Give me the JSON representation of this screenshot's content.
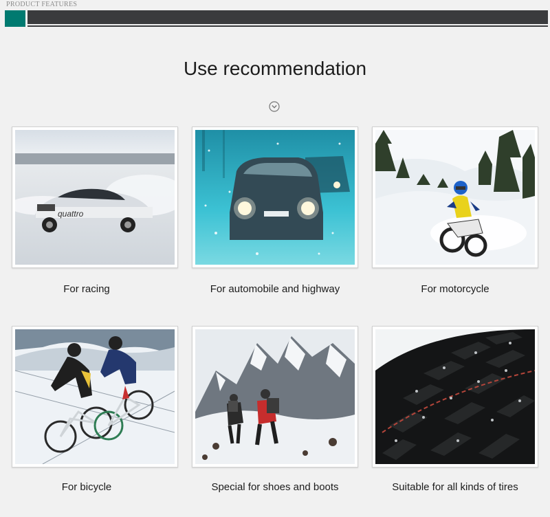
{
  "header": {
    "label": "PRODUCT FEATURES",
    "accent_color": "#007a70",
    "bar_color": "#3a3b3d"
  },
  "section": {
    "title": "Use recommendation",
    "chevron_icon": "chevron-down-circle-icon"
  },
  "cards": [
    {
      "caption": "For racing",
      "image": "rally-car-on-snow"
    },
    {
      "caption": "For automobile and highway",
      "image": "car-headlights-in-snowstorm"
    },
    {
      "caption": "For motorcycle",
      "image": "motocross-rider-in-snow"
    },
    {
      "caption": "For bicycle",
      "image": "cyclists-in-snow"
    },
    {
      "caption": "Special for shoes and boots",
      "image": "hikers-on-snowy-mountain"
    },
    {
      "caption": "Suitable for all kinds of tires",
      "image": "studded-winter-tire"
    }
  ]
}
